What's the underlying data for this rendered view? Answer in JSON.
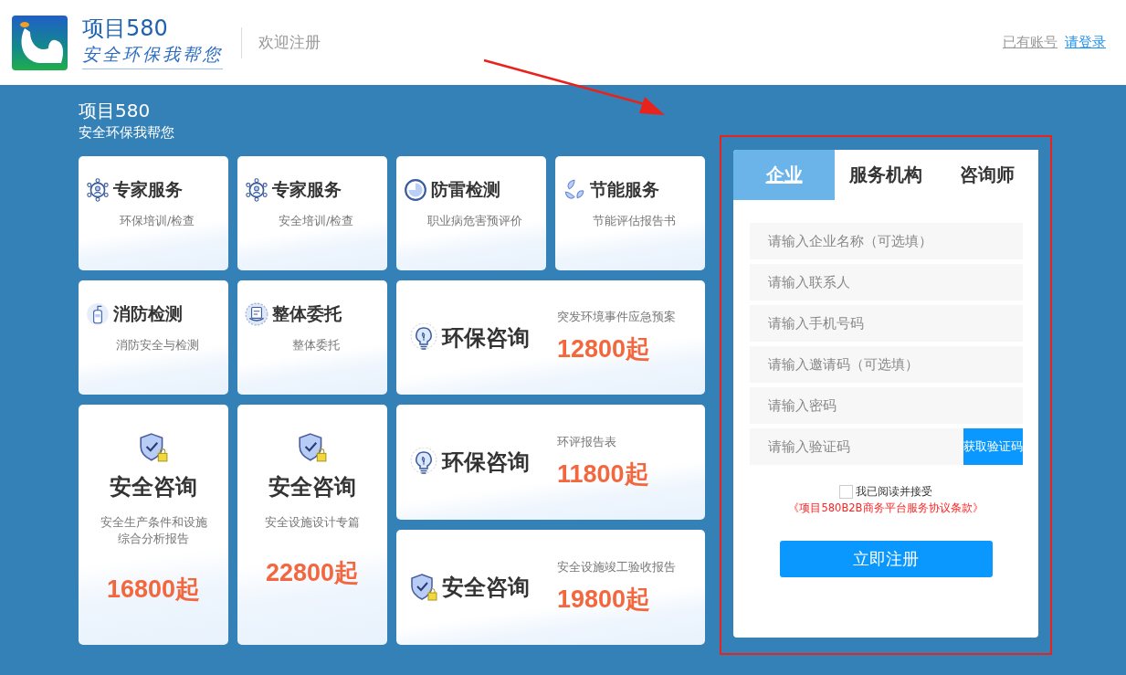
{
  "header": {
    "brand": "项目580",
    "slogan": "安全环保我帮您",
    "page_title": "欢迎注册",
    "login_prompt": "已有账号",
    "login_link": "请登录"
  },
  "hero": {
    "title": "项目580",
    "subtitle": "安全环保我帮您"
  },
  "cards": [
    {
      "kind": "small",
      "title": "专家服务",
      "subtitle": "环保培训/检查"
    },
    {
      "kind": "small",
      "title": "专家服务",
      "subtitle": "安全培训/检查"
    },
    {
      "kind": "small",
      "title": "防雷检测",
      "subtitle": "职业病危害预评价"
    },
    {
      "kind": "small",
      "title": "节能服务",
      "subtitle": "节能评估报告书"
    },
    {
      "kind": "small",
      "title": "消防检测",
      "subtitle": "消防安全与检测"
    },
    {
      "kind": "small",
      "title": "整体委托",
      "subtitle": "整体委托"
    },
    {
      "kind": "wide",
      "title": "环保咨询",
      "subtitle": "突发环境事件应急预案",
      "price": "12800起"
    },
    {
      "kind": "tall",
      "title": "安全咨询",
      "subtitle": "安全生产条件和设施综合分析报告",
      "price": "16800起"
    },
    {
      "kind": "tall",
      "title": "安全咨询",
      "subtitle": "安全设施设计专篇",
      "price": "22800起"
    },
    {
      "kind": "wide",
      "title": "环保咨询",
      "subtitle": "环评报告表",
      "price": "11800起"
    },
    {
      "kind": "wide",
      "title": "安全咨询",
      "subtitle": "安全设施竣工验收报告",
      "price": "19800起"
    }
  ],
  "form": {
    "tabs": [
      {
        "label": "企业",
        "selected": true
      },
      {
        "label": "服务机构",
        "selected": false
      },
      {
        "label": "咨询师",
        "selected": false
      }
    ],
    "fields": [
      {
        "kind": "text",
        "placeholder": "请输入企业名称（可选填）"
      },
      {
        "kind": "text",
        "placeholder": "请输入联系人"
      },
      {
        "kind": "text",
        "placeholder": "请输入手机号码"
      },
      {
        "kind": "text",
        "placeholder": "请输入邀请码（可选填）"
      },
      {
        "kind": "password",
        "placeholder": "请输入密码"
      },
      {
        "kind": "code",
        "placeholder": "请输入验证码",
        "button": "获取验证码"
      }
    ],
    "agreement": {
      "checked": false,
      "label": "我已阅读并接受",
      "link": "《项目580B2B商务平台服务协议条款》"
    },
    "submit": "立即注册"
  }
}
